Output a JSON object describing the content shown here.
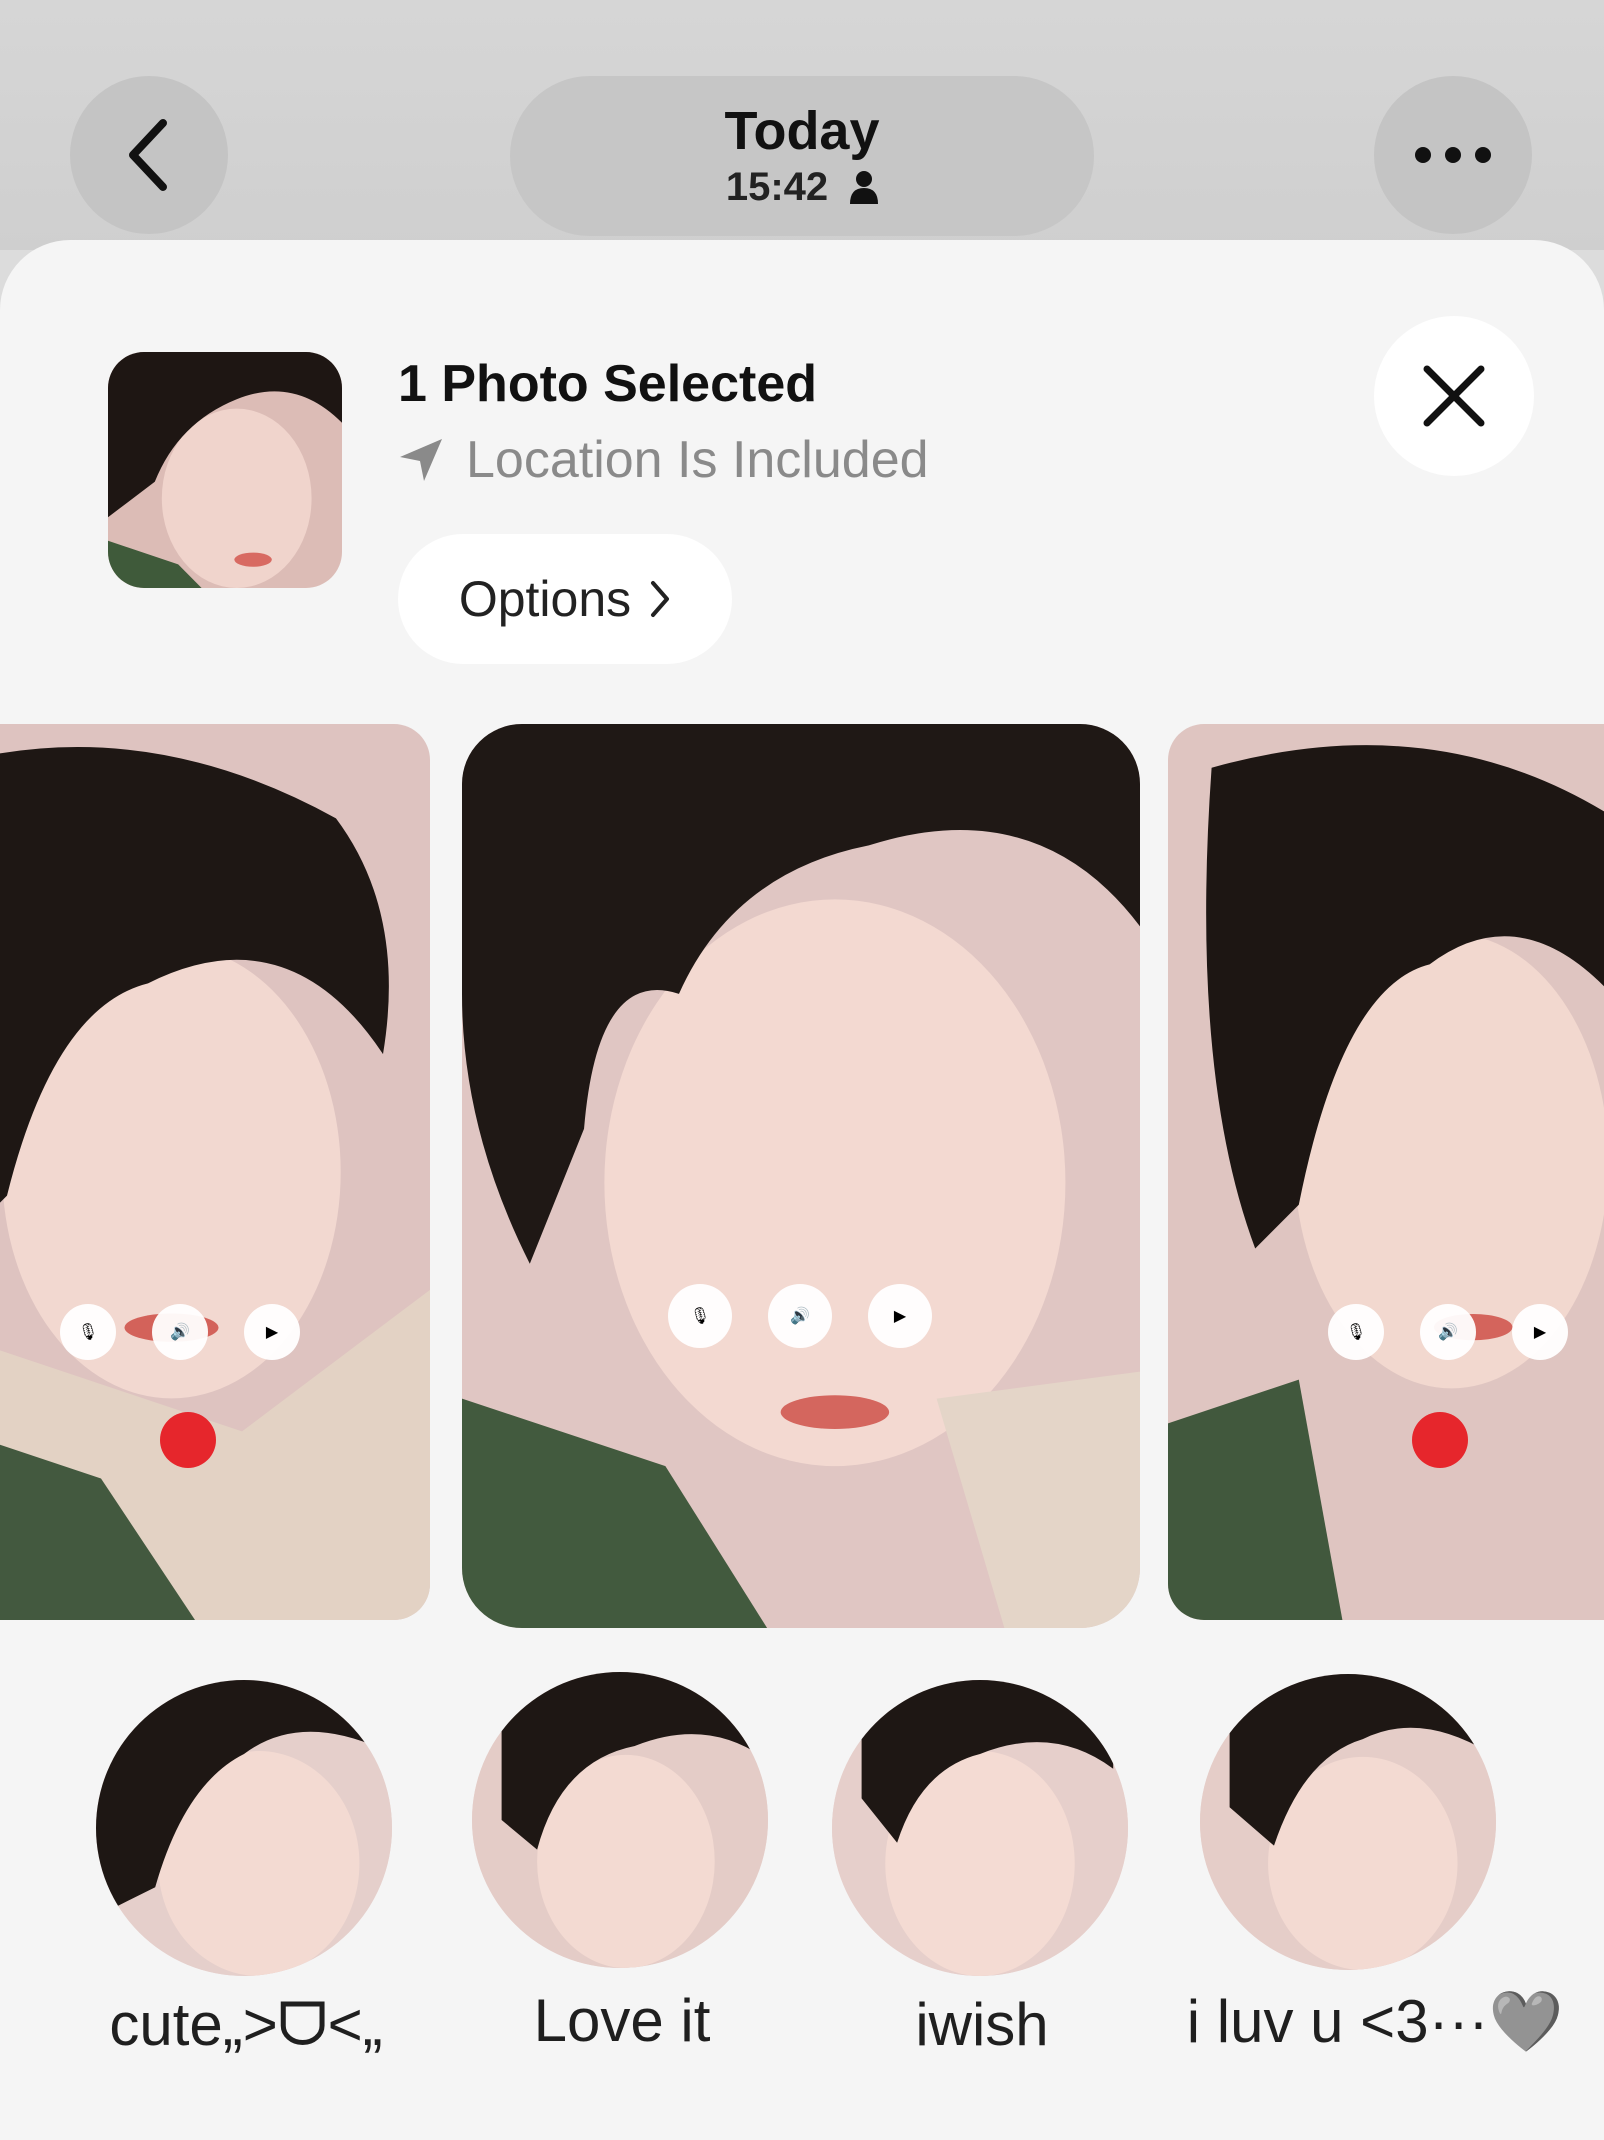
{
  "header": {
    "title": "Today",
    "time": "15:42",
    "back_icon": "chevron-left-icon",
    "more_icon": "ellipsis-icon",
    "person_icon": "person-icon"
  },
  "selection": {
    "title": "1 Photo Selected",
    "location_text": "Location Is Included",
    "location_icon": "location-arrow-icon",
    "options_label": "Options",
    "close_icon": "close-icon"
  },
  "stickers": [
    {
      "caption": "cute„>ᗜ<„"
    },
    {
      "caption": "Love it"
    },
    {
      "caption": "iwish"
    },
    {
      "caption": "i luv u <3···🩶"
    }
  ],
  "colors": {
    "sheet_bg": "#f5f5f5",
    "header_bg": "#d6d6d6",
    "end_call_red": "#e6262c"
  }
}
